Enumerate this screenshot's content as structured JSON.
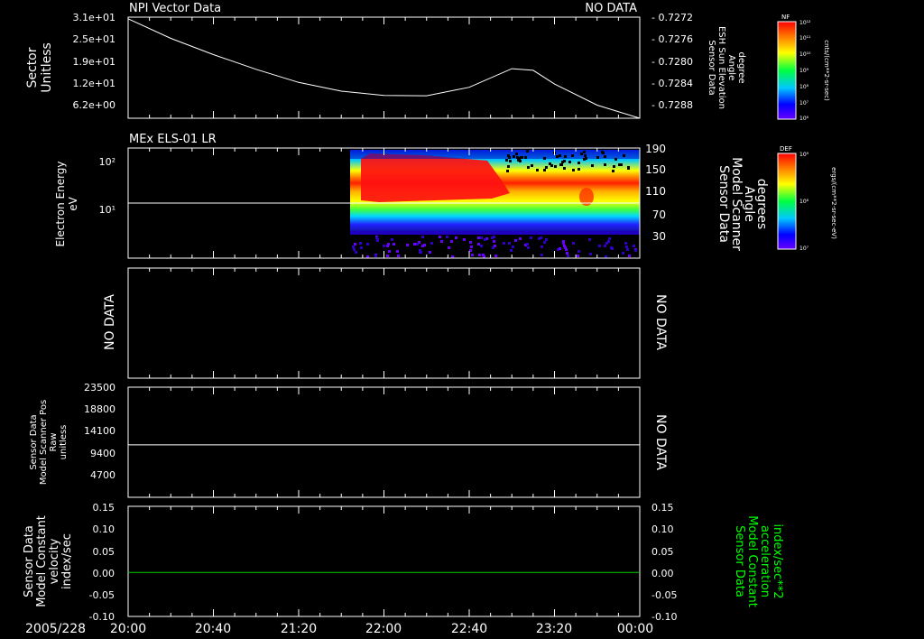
{
  "colors": {
    "background": "#000000",
    "axes": "#ffffff",
    "text": "#ffffff",
    "velocity_line": "#00cc00",
    "acceleration_label": "#00ff00"
  },
  "x_axis": {
    "date_label": "2005/228",
    "ticks": [
      "20:00",
      "20:40",
      "21:20",
      "22:00",
      "22:40",
      "23:20",
      "00:00"
    ],
    "range": [
      "2005-08-16T20:00",
      "2005-08-17T00:00"
    ]
  },
  "panels": {
    "p1": {
      "title": "NPI Vector Data",
      "status": "NO DATA",
      "ylabel_left": [
        "Sector",
        "Unitless"
      ],
      "left_ticks": [
        "3.1e+01",
        "2.5e+01",
        "1.9e+01",
        "1.2e+01",
        "6.2e+00"
      ],
      "right_ticks": [
        "- 0.7272",
        "- 0.7276",
        "- 0.7280",
        "- 0.7284",
        "- 0.7288"
      ],
      "ylabel_right": [
        "Sensor Data",
        "ESH Sun Elevation",
        "Angle",
        "degree"
      ]
    },
    "p2": {
      "title": "MEx ELS-01 LR",
      "ylabel_left": [
        "Electron Energy",
        "eV"
      ],
      "left_ticks": [
        "10²",
        "10¹"
      ],
      "right_ticks": [
        "190",
        "150",
        "110",
        "70",
        "30"
      ],
      "ylabel_right": [
        "Sensor Data",
        "Model Scanner",
        "Angle",
        "degrees"
      ]
    },
    "p3": {
      "left_label": "NO DATA",
      "right_label": "NO DATA"
    },
    "p4": {
      "left_ticks": [
        "23500",
        "18800",
        "14100",
        "9400",
        "4700"
      ],
      "ylabel_left": [
        "Sensor Data",
        "Model Scanner Pos",
        "Raw",
        "unitless"
      ],
      "right_label": "NO DATA"
    },
    "p5": {
      "left_ticks": [
        "0.15",
        "0.10",
        "0.05",
        "0.00",
        "-0.05",
        "-0.10"
      ],
      "right_ticks": [
        "0.15",
        "0.10",
        "0.05",
        "0.00",
        "-0.05",
        "-0.10"
      ],
      "ylabel_left": [
        "Sensor Data",
        "Model Constant",
        "velocity",
        "index/sec"
      ],
      "ylabel_right": [
        "Sensor Data",
        "Model Constant",
        "acceleration",
        "index/sec**2"
      ]
    }
  },
  "colorbars": {
    "cb1": {
      "label": "NF",
      "ticks": [
        "10¹²",
        "10¹¹",
        "10¹⁰",
        "10⁹",
        "10⁸",
        "10⁷",
        "10⁶"
      ],
      "unit": "cnts/(cm**2-sr-sec)"
    },
    "cb2": {
      "label": "DEF",
      "ticks": [
        "10⁹",
        "10⁸",
        "10⁷"
      ],
      "unit": "ergs/(cm**2-sr-sec-eV)"
    }
  },
  "chart_data": [
    {
      "type": "line",
      "title": "NPI Vector Data",
      "status": "NO DATA",
      "ylabel": "Sector Unitless",
      "y2label": "Sensor Data ESH Sun Elevation Angle degree",
      "ylim": [
        0,
        31
      ],
      "series": [
        {
          "x": [
            "20:00",
            "20:20",
            "20:40",
            "21:00",
            "21:20",
            "21:40",
            "22:00",
            "22:20",
            "22:40",
            "23:00",
            "23:10",
            "23:20",
            "23:40",
            "00:00"
          ],
          "values": [
            30.5,
            24.5,
            19.5,
            15.0,
            11.0,
            8.3,
            7.0,
            6.9,
            9.5,
            15.2,
            14.7,
            10.5,
            4.0,
            -1.0
          ]
        }
      ]
    },
    {
      "type": "heatmap",
      "title": "MEx ELS-01 LR",
      "ylabel": "Electron Energy eV",
      "y2label": "Sensor Data Model Scanner Angle degrees",
      "ylim": [
        3,
        200
      ],
      "y2lim": [
        0,
        190
      ],
      "data_start": "21:40",
      "colorbar": {
        "label": "DEF",
        "range": [
          "1e7",
          "1e9"
        ],
        "unit": "ergs/(cm**2-sr-sec-eV)"
      },
      "overlay": {
        "scanner_angle_degrees": 90
      }
    },
    {
      "type": "line",
      "status": "NO DATA",
      "y2label": "NO DATA"
    },
    {
      "type": "line",
      "ylabel": "Sensor Data Model Scanner Pos Raw unitless",
      "ylim": [
        0,
        23500
      ],
      "y2label": "NO DATA",
      "series": [
        {
          "x": [
            "20:00",
            "00:00"
          ],
          "values": [
            11200,
            11200
          ]
        }
      ]
    },
    {
      "type": "line",
      "ylabel": "Sensor Data Model Constant velocity index/sec",
      "y2label": "Sensor Data Model Constant acceleration index/sec**2",
      "ylim": [
        -0.1,
        0.15
      ],
      "series": [
        {
          "x": [
            "20:00",
            "00:00"
          ],
          "values": [
            0.0,
            0.0
          ]
        }
      ]
    }
  ]
}
